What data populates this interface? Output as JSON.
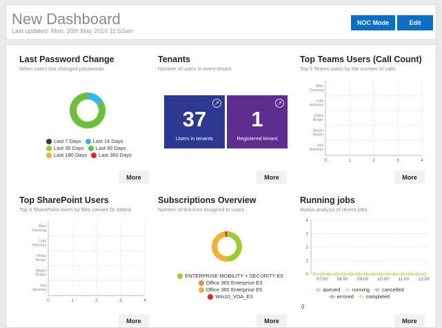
{
  "header": {
    "title": "New Dashboard",
    "last_updated": "Last updated: Mon, 20th May 2019 11:53am",
    "noc_mode_label": "NOC Mode",
    "edit_label": "Edit"
  },
  "cards": {
    "password": {
      "title": "Last Password Change",
      "subtitle": "When users last changed passwords",
      "more": "More",
      "legend": [
        {
          "label": "Last 7 Days",
          "color": "#1e4d2b"
        },
        {
          "label": "Last 14 Days",
          "color": "#35b8e8"
        },
        {
          "label": "Last 30 Days",
          "color": "#9acd32"
        },
        {
          "label": "Last 90 Days",
          "color": "#6bbf3a"
        },
        {
          "label": "Last 180 Days",
          "color": "#f5b031"
        },
        {
          "label": "Last 360 Days",
          "color": "#e8202a"
        }
      ]
    },
    "tenants": {
      "title": "Tenants",
      "subtitle": "Number of users in every tenant",
      "more": "More",
      "tiles": [
        {
          "value": "37",
          "label": "Users in tenants",
          "color": "#2d3990"
        },
        {
          "value": "1",
          "label": "Registered tenant",
          "color": "#5f2d90"
        }
      ],
      "arrow_icon": "external-link-icon"
    },
    "teams": {
      "title": "Top Teams Users (Call Count)",
      "subtitle": "Top 5 Teams users by the number of calls",
      "more": "More",
      "x_ticks": [
        "0",
        "1",
        "2",
        "3",
        "4"
      ],
      "y_labels": [
        "Allan Deyoung",
        "Lidia Holloway",
        "Debra Berger",
        "Megan Bowen",
        "Joni Sherman"
      ]
    },
    "sharepoint": {
      "title": "Top SharePoint Users",
      "subtitle": "Top 5 SharePoint users by files viewed Or edited",
      "more": "More",
      "x_ticks": [
        "0",
        "1",
        "2",
        "3",
        "4"
      ],
      "y_labels": [
        "Allan Deyoung",
        "Lidia Holloway",
        "Debra Berger",
        "Megan Bowen",
        "Joni Sherman"
      ]
    },
    "subscriptions": {
      "title": "Subscriptions Overview",
      "subtitle": "Number of licences assigned to users",
      "more": "More",
      "legend": [
        {
          "label": "ENTERPRISE MOBILITY + SECURITY E5",
          "color": "#9acd32"
        },
        {
          "label": "Office 365 Enterprise E3",
          "color": "#f08a3c"
        },
        {
          "label": "Office 365 Enterprise E5",
          "color": "#f5b031"
        },
        {
          "label": "Win10_VDA_E3",
          "color": "#e8202a"
        }
      ]
    },
    "jobs": {
      "title": "Running jobs",
      "subtitle": "Status analysis of recent jobs",
      "more": "More",
      "y_ticks": [
        "0",
        "1",
        "2",
        "3",
        "4"
      ],
      "x_ticks": [
        "07:00",
        "08:00",
        "09:00",
        "10:00",
        "11:00",
        "12:00"
      ],
      "legend": [
        {
          "label": "queued",
          "color": "#35b8e8"
        },
        {
          "label": "running",
          "color": "#f5b031"
        },
        {
          "label": "cancelled",
          "color": "#5a5aa8"
        },
        {
          "label": "errored",
          "color": "#e8202a"
        },
        {
          "label": "completed",
          "color": "#9acd32"
        }
      ],
      "total": "0"
    }
  },
  "chart_data": [
    {
      "type": "pie",
      "title": "Last Password Change",
      "categories": [
        "Last 7 Days",
        "Last 14 Days",
        "Last 30 Days",
        "Last 90 Days",
        "Last 180 Days",
        "Last 360 Days"
      ],
      "values": [
        0,
        2,
        0,
        10,
        0,
        0
      ]
    },
    {
      "type": "pie",
      "title": "Subscriptions Overview",
      "categories": [
        "ENTERPRISE MOBILITY + SECURITY E5",
        "Office 365 Enterprise E3",
        "Office 365 Enterprise E5",
        "Win10_VDA_E3"
      ],
      "values": [
        25,
        0,
        25,
        1
      ]
    },
    {
      "type": "line",
      "title": "Running jobs",
      "x": [
        "07:00",
        "07:20",
        "07:40",
        "08:00",
        "08:20",
        "08:40",
        "09:00",
        "09:20",
        "09:40",
        "10:00",
        "10:20",
        "10:40",
        "11:00",
        "11:20",
        "11:40",
        "12:00"
      ],
      "series": [
        {
          "name": "queued",
          "values": [
            0,
            0,
            0,
            0,
            0,
            0,
            0,
            0,
            0,
            0,
            0,
            0,
            0,
            0,
            0,
            0
          ]
        },
        {
          "name": "running",
          "values": [
            0,
            0,
            0,
            0,
            0,
            0,
            0,
            0,
            0,
            0,
            0,
            0,
            0,
            0,
            0,
            0
          ]
        },
        {
          "name": "cancelled",
          "values": [
            0,
            0,
            0,
            0,
            0,
            0,
            0,
            0,
            0,
            0,
            0,
            0,
            0,
            0,
            0,
            0
          ]
        },
        {
          "name": "errored",
          "values": [
            0,
            0,
            0,
            0,
            0,
            0,
            0,
            0,
            0,
            0,
            0,
            0,
            0,
            0,
            0,
            0
          ]
        },
        {
          "name": "completed",
          "values": [
            0,
            0,
            0,
            0,
            0,
            0,
            0,
            0,
            0,
            0,
            0,
            0,
            0,
            0,
            0,
            0
          ]
        }
      ],
      "ylim": [
        0,
        4
      ]
    }
  ]
}
